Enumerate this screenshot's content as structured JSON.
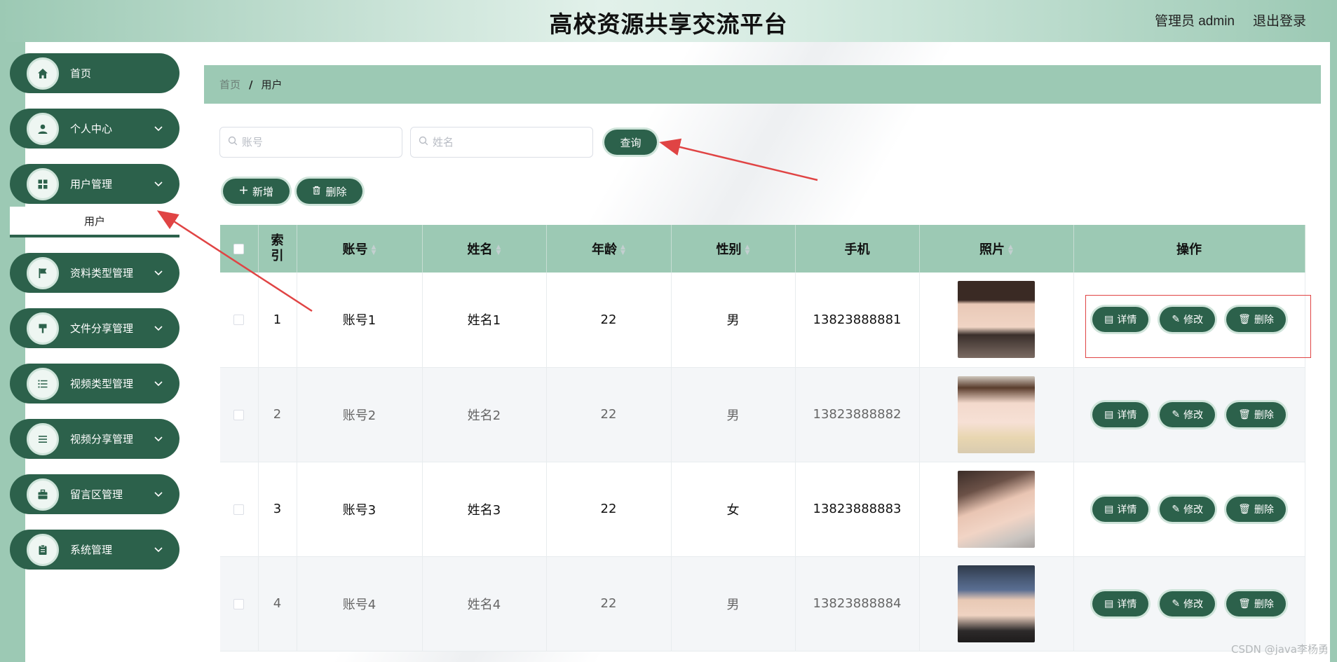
{
  "header": {
    "title": "高校资源共享交流平台",
    "admin_label": "管理员 admin",
    "logout_label": "退出登录"
  },
  "sidebar": {
    "items": [
      {
        "label": "首页",
        "icon": "home-icon",
        "has_arrow": false
      },
      {
        "label": "个人中心",
        "icon": "user-icon",
        "has_arrow": true
      },
      {
        "label": "用户管理",
        "icon": "grid-icon",
        "has_arrow": true,
        "expanded": true
      },
      {
        "label": "资料类型管理",
        "icon": "flag-icon",
        "has_arrow": true
      },
      {
        "label": "文件分享管理",
        "icon": "paint-icon",
        "has_arrow": true
      },
      {
        "label": "视频类型管理",
        "icon": "list-icon",
        "has_arrow": true
      },
      {
        "label": "视频分享管理",
        "icon": "menu-icon",
        "has_arrow": true
      },
      {
        "label": "留言区管理",
        "icon": "briefcase-icon",
        "has_arrow": true
      },
      {
        "label": "系统管理",
        "icon": "clipboard-icon",
        "has_arrow": true
      }
    ],
    "submenu_label": "用户"
  },
  "breadcrumb": {
    "home": "首页",
    "separator": "/",
    "current": "用户"
  },
  "search": {
    "account_placeholder": "账号",
    "name_placeholder": "姓名",
    "query_label": "查询"
  },
  "toolbar": {
    "add_label": "新增",
    "delete_label": "删除"
  },
  "table": {
    "headers": {
      "index": "索引",
      "account": "账号",
      "name": "姓名",
      "age": "年龄",
      "gender": "性别",
      "phone": "手机",
      "photo": "照片",
      "actions": "操作"
    },
    "action_labels": {
      "detail": "详情",
      "edit": "修改",
      "delete": "删除"
    },
    "rows": [
      {
        "index": "1",
        "account": "账号1",
        "name": "姓名1",
        "age": "22",
        "gender": "男",
        "phone": "13823888881"
      },
      {
        "index": "2",
        "account": "账号2",
        "name": "姓名2",
        "age": "22",
        "gender": "男",
        "phone": "13823888882"
      },
      {
        "index": "3",
        "account": "账号3",
        "name": "姓名3",
        "age": "22",
        "gender": "女",
        "phone": "13823888883"
      },
      {
        "index": "4",
        "account": "账号4",
        "name": "姓名4",
        "age": "22",
        "gender": "男",
        "phone": "13823888884"
      }
    ]
  },
  "watermark": "CSDN @java李杨勇",
  "colors": {
    "accent": "#2c614b",
    "header_bg": "#9cc9b4",
    "annotation": "#e04444"
  }
}
